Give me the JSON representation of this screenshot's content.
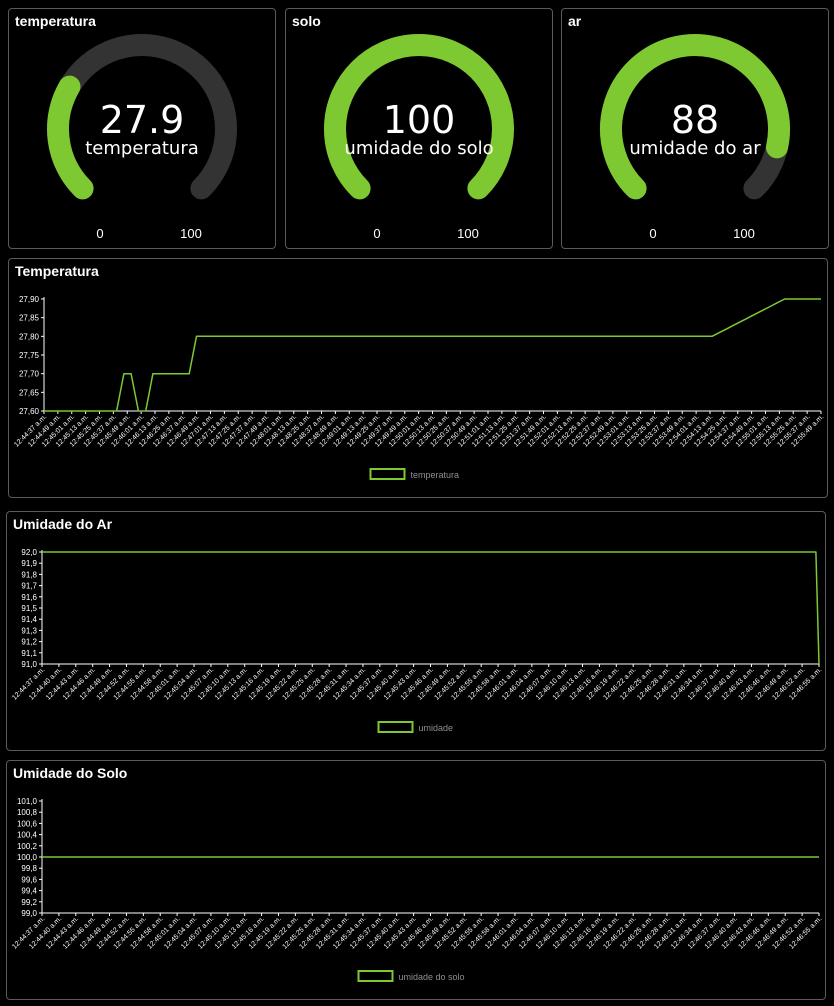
{
  "colors": {
    "accent": "#7ec832",
    "track": "#333333",
    "border": "#5a5a5a"
  },
  "gauges": [
    {
      "title": "temperatura",
      "value": "27.9",
      "label": "temperatura",
      "min": "0",
      "max": "100",
      "level": 0.279
    },
    {
      "title": "solo",
      "value": "100",
      "label": "umidade do solo",
      "min": "0",
      "max": "100",
      "level": 1.0
    },
    {
      "title": "ar",
      "value": "88",
      "label": "umidade do ar",
      "min": "0",
      "max": "100",
      "level": 0.88
    }
  ],
  "chart_data": [
    {
      "type": "line",
      "title": "Temperatura",
      "series": [
        {
          "name": "temperatura",
          "values": [
            27.6,
            27.6,
            27.6,
            27.6,
            27.6,
            27.6,
            27.6,
            27.6,
            27.6,
            27.6,
            27.6,
            27.7,
            27.7,
            27.6,
            27.6,
            27.7,
            27.7,
            27.7,
            27.7,
            27.7,
            27.7,
            27.8,
            27.8,
            27.8,
            27.8,
            27.8,
            27.8,
            27.8,
            27.8,
            27.8,
            27.8,
            27.8,
            27.8,
            27.8,
            27.8,
            27.8,
            27.8,
            27.8,
            27.8,
            27.8,
            27.8,
            27.8,
            27.8,
            27.8,
            27.8,
            27.8,
            27.8,
            27.8,
            27.8,
            27.8,
            27.8,
            27.8,
            27.8,
            27.8,
            27.8,
            27.8,
            27.8,
            27.8,
            27.8,
            27.8,
            27.8,
            27.8,
            27.8,
            27.8,
            27.8,
            27.8,
            27.8,
            27.8,
            27.8,
            27.8,
            27.8,
            27.8,
            27.8,
            27.8,
            27.8,
            27.8,
            27.8,
            27.8,
            27.8,
            27.8,
            27.8,
            27.8,
            27.8,
            27.8,
            27.8,
            27.8,
            27.8,
            27.8,
            27.8,
            27.8,
            27.8,
            27.8,
            27.8,
            27.81,
            27.82,
            27.83,
            27.84,
            27.85,
            27.86,
            27.87,
            27.88,
            27.89,
            27.9,
            27.9,
            27.9,
            27.9,
            27.9,
            27.9
          ]
        }
      ],
      "yticks": [
        "27,60",
        "27,65",
        "27,70",
        "27,75",
        "27,80",
        "27,85",
        "27,90"
      ],
      "ylim": [
        27.6,
        27.9
      ],
      "xticks": [
        "12:44:37 a.m.",
        "12:44:49 a.m.",
        "12:45:01 a.m.",
        "12:45:13 a.m.",
        "12:45:25 a.m.",
        "12:45:37 a.m.",
        "12:45:49 a.m.",
        "12:46:01 a.m.",
        "12:46:13 a.m.",
        "12:46:25 a.m.",
        "12:46:37 a.m.",
        "12:46:49 a.m.",
        "12:47:01 a.m.",
        "12:47:13 a.m.",
        "12:47:25 a.m.",
        "12:47:37 a.m.",
        "12:47:49 a.m.",
        "12:48:01 a.m.",
        "12:48:13 a.m.",
        "12:48:25 a.m.",
        "12:48:37 a.m.",
        "12:48:49 a.m.",
        "12:49:01 a.m.",
        "12:49:13 a.m.",
        "12:49:25 a.m.",
        "12:49:37 a.m.",
        "12:49:49 a.m.",
        "12:50:01 a.m.",
        "12:50:13 a.m.",
        "12:50:25 a.m.",
        "12:50:37 a.m.",
        "12:50:49 a.m.",
        "12:51:01 a.m.",
        "12:51:13 a.m.",
        "12:51:25 a.m.",
        "12:51:37 a.m.",
        "12:51:49 a.m.",
        "12:52:01 a.m.",
        "12:52:13 a.m.",
        "12:52:25 a.m.",
        "12:52:37 a.m.",
        "12:52:49 a.m.",
        "12:53:01 a.m.",
        "12:53:13 a.m.",
        "12:53:25 a.m.",
        "12:53:37 a.m.",
        "12:53:49 a.m.",
        "12:54:01 a.m.",
        "12:54:13 a.m.",
        "12:54:25 a.m.",
        "12:54:37 a.m.",
        "12:54:49 a.m.",
        "12:55:01 a.m.",
        "12:55:13 a.m.",
        "12:55:25 a.m.",
        "12:55:37 a.m.",
        "12:55:49 a.m."
      ],
      "legend": "temperatura"
    },
    {
      "type": "line",
      "title": "Umidade do Ar",
      "series": [
        {
          "name": "umidade",
          "values": [
            92,
            92,
            92,
            92,
            92,
            92,
            92,
            92,
            92,
            92,
            92,
            92,
            92,
            92,
            92,
            92,
            92,
            92,
            92,
            92,
            92,
            92,
            92,
            92,
            92,
            92,
            92,
            92,
            92,
            92,
            92,
            92,
            92,
            92,
            92,
            92,
            92,
            92,
            92,
            92,
            92,
            92,
            92,
            92,
            92,
            92,
            92,
            92,
            92,
            92,
            92,
            92,
            92,
            92,
            92,
            92,
            92,
            92,
            92,
            92,
            92,
            92,
            92,
            92,
            92,
            92,
            92,
            92,
            92,
            92,
            92,
            92,
            92,
            92,
            92,
            92,
            92,
            92,
            92,
            92,
            92,
            92,
            92,
            92,
            92,
            92,
            92,
            92,
            92,
            92,
            92,
            92,
            92,
            92,
            92,
            92,
            92,
            92,
            92,
            92,
            92,
            92,
            92,
            92,
            92,
            92,
            92,
            92,
            92,
            92,
            92,
            92,
            92,
            92,
            92,
            92,
            92,
            92,
            92,
            92,
            92,
            92,
            92,
            92,
            92,
            92,
            92,
            92,
            92,
            92,
            92,
            92,
            92,
            92,
            92,
            92,
            92,
            92,
            92,
            92,
            92,
            92,
            92,
            92,
            92,
            92,
            92,
            92,
            92,
            92,
            92,
            92,
            92,
            92,
            92,
            92,
            92,
            92,
            92,
            92,
            92,
            92,
            92,
            92,
            92,
            92,
            92,
            92,
            92,
            92,
            92,
            92,
            92,
            92,
            92,
            92,
            92,
            92,
            92,
            92,
            92,
            92,
            92,
            92,
            92,
            92,
            92,
            92,
            92,
            92,
            92,
            92,
            92,
            92,
            92,
            92,
            92,
            92,
            92,
            92,
            92,
            92,
            92,
            92,
            92,
            92,
            92,
            92,
            92,
            92,
            92,
            92,
            92,
            92,
            92,
            92,
            92,
            92,
            92,
            92,
            92,
            92,
            92,
            92,
            92,
            92,
            92,
            92,
            92,
            92,
            92,
            92,
            92,
            92,
            92,
            92,
            92,
            92,
            92,
            92,
            92,
            92,
            92,
            92,
            92,
            92,
            92,
            92,
            92,
            92,
            92,
            92,
            92,
            91
          ]
        }
      ],
      "yticks": [
        "91,0",
        "91,1",
        "91,2",
        "91,3",
        "91,4",
        "91,5",
        "91,6",
        "91,7",
        "91,8",
        "91,9",
        "92,0"
      ],
      "ylim": [
        91.0,
        92.0
      ],
      "xticks": [
        "12:44:37 a.m.",
        "12:44:40 a.m.",
        "12:44:43 a.m.",
        "12:44:46 a.m.",
        "12:44:49 a.m.",
        "12:44:52 a.m.",
        "12:44:55 a.m.",
        "12:44:58 a.m.",
        "12:45:01 a.m.",
        "12:45:04 a.m.",
        "12:45:07 a.m.",
        "12:45:10 a.m.",
        "12:45:13 a.m.",
        "12:45:16 a.m.",
        "12:45:19 a.m.",
        "12:45:22 a.m.",
        "12:45:25 a.m.",
        "12:45:28 a.m.",
        "12:45:31 a.m.",
        "12:45:34 a.m.",
        "12:45:37 a.m.",
        "12:45:40 a.m.",
        "12:45:43 a.m.",
        "12:45:46 a.m.",
        "12:45:49 a.m.",
        "12:45:52 a.m.",
        "12:45:55 a.m.",
        "12:45:58 a.m.",
        "12:46:01 a.m.",
        "12:46:04 a.m.",
        "12:46:07 a.m.",
        "12:46:10 a.m.",
        "12:46:13 a.m.",
        "12:46:16 a.m.",
        "12:46:19 a.m.",
        "12:46:22 a.m.",
        "12:46:25 a.m.",
        "12:46:28 a.m.",
        "12:46:31 a.m.",
        "12:46:34 a.m.",
        "12:46:37 a.m.",
        "12:46:40 a.m.",
        "12:46:43 a.m.",
        "12:46:46 a.m.",
        "12:46:49 a.m.",
        "12:46:52 a.m.",
        "12:46:55 a.m."
      ],
      "legend": "umidade"
    },
    {
      "type": "line",
      "title": "Umidade do Solo",
      "series": [
        {
          "name": "umidade do solo",
          "values": [
            100,
            100
          ]
        }
      ],
      "yticks": [
        "99,0",
        "99,2",
        "99,4",
        "99,6",
        "99,8",
        "100,0",
        "100,2",
        "100,4",
        "100,6",
        "100,8",
        "101,0"
      ],
      "ylim": [
        99.0,
        101.0
      ],
      "xticks": [
        "12:44:37 a.m.",
        "12:44:40 a.m.",
        "12:44:43 a.m.",
        "12:44:46 a.m.",
        "12:44:49 a.m.",
        "12:44:52 a.m.",
        "12:44:55 a.m.",
        "12:44:58 a.m.",
        "12:45:01 a.m.",
        "12:45:04 a.m.",
        "12:45:07 a.m.",
        "12:45:10 a.m.",
        "12:45:13 a.m.",
        "12:45:16 a.m.",
        "12:45:19 a.m.",
        "12:45:22 a.m.",
        "12:45:25 a.m.",
        "12:45:28 a.m.",
        "12:45:31 a.m.",
        "12:45:34 a.m.",
        "12:45:37 a.m.",
        "12:45:40 a.m.",
        "12:45:43 a.m.",
        "12:45:46 a.m.",
        "12:45:49 a.m.",
        "12:45:52 a.m.",
        "12:45:55 a.m.",
        "12:45:58 a.m.",
        "12:46:01 a.m.",
        "12:46:04 a.m.",
        "12:46:07 a.m.",
        "12:46:10 a.m.",
        "12:46:13 a.m.",
        "12:46:16 a.m.",
        "12:46:19 a.m.",
        "12:46:22 a.m.",
        "12:46:25 a.m.",
        "12:46:28 a.m.",
        "12:46:31 a.m.",
        "12:46:34 a.m.",
        "12:46:37 a.m.",
        "12:46:40 a.m.",
        "12:46:43 a.m.",
        "12:46:46 a.m.",
        "12:46:49 a.m.",
        "12:46:52 a.m.",
        "12:46:55 a.m."
      ],
      "legend": "umidade do solo"
    }
  ]
}
